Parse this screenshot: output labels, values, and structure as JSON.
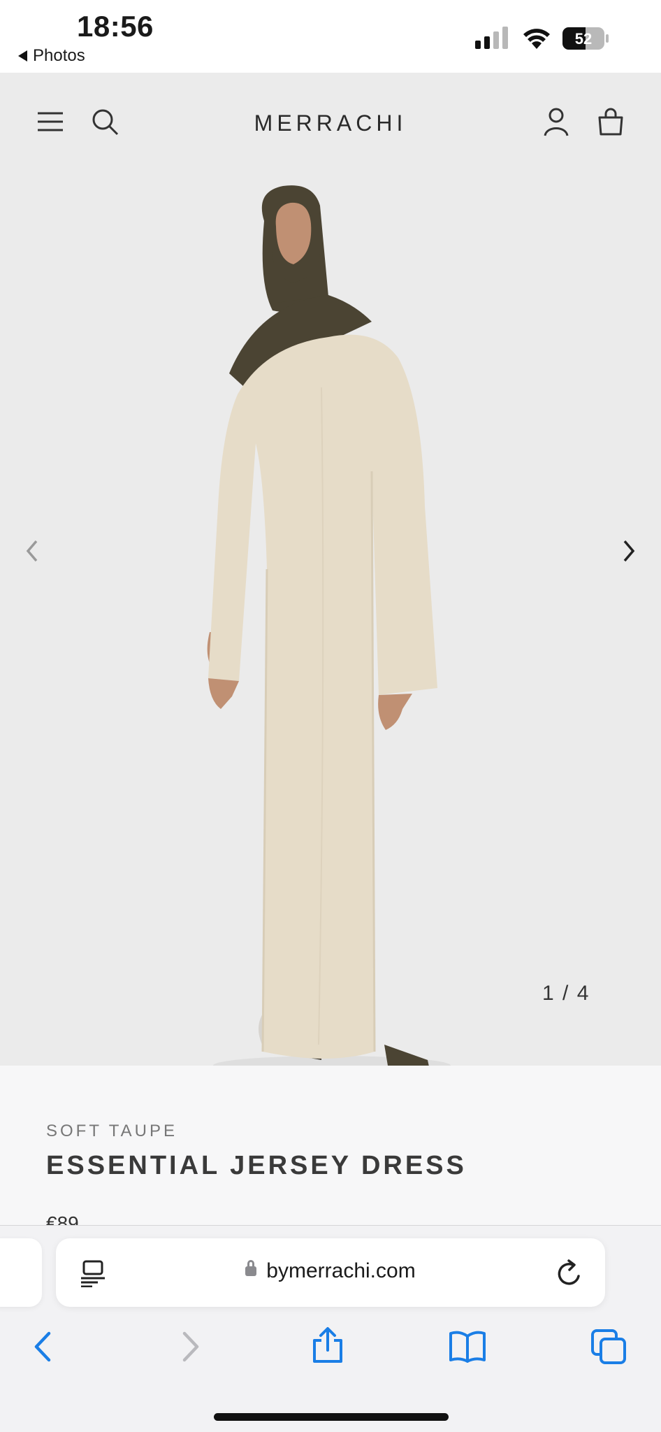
{
  "status_bar": {
    "time": "18:56",
    "back_label": "Photos",
    "battery": "52"
  },
  "header": {
    "logo": "MERRACHI",
    "icons": [
      "menu-icon",
      "search-icon",
      "account-icon",
      "bag-icon"
    ]
  },
  "gallery": {
    "pager": "1 / 4",
    "current_index": 1,
    "total": 4,
    "colors": {
      "background": "#ebebeb",
      "dress": "#e6dcc8",
      "hijab": "#4b4433"
    }
  },
  "product": {
    "color_name": "SOFT TAUPE",
    "title": "ESSENTIAL JERSEY DRESS",
    "price": "€89"
  },
  "browser": {
    "url": "bymerrachi.com",
    "toolbar_icons": [
      "back-icon",
      "forward-icon",
      "share-icon",
      "bookmarks-icon",
      "tabs-icon"
    ],
    "accent": "#1a7ee6"
  }
}
